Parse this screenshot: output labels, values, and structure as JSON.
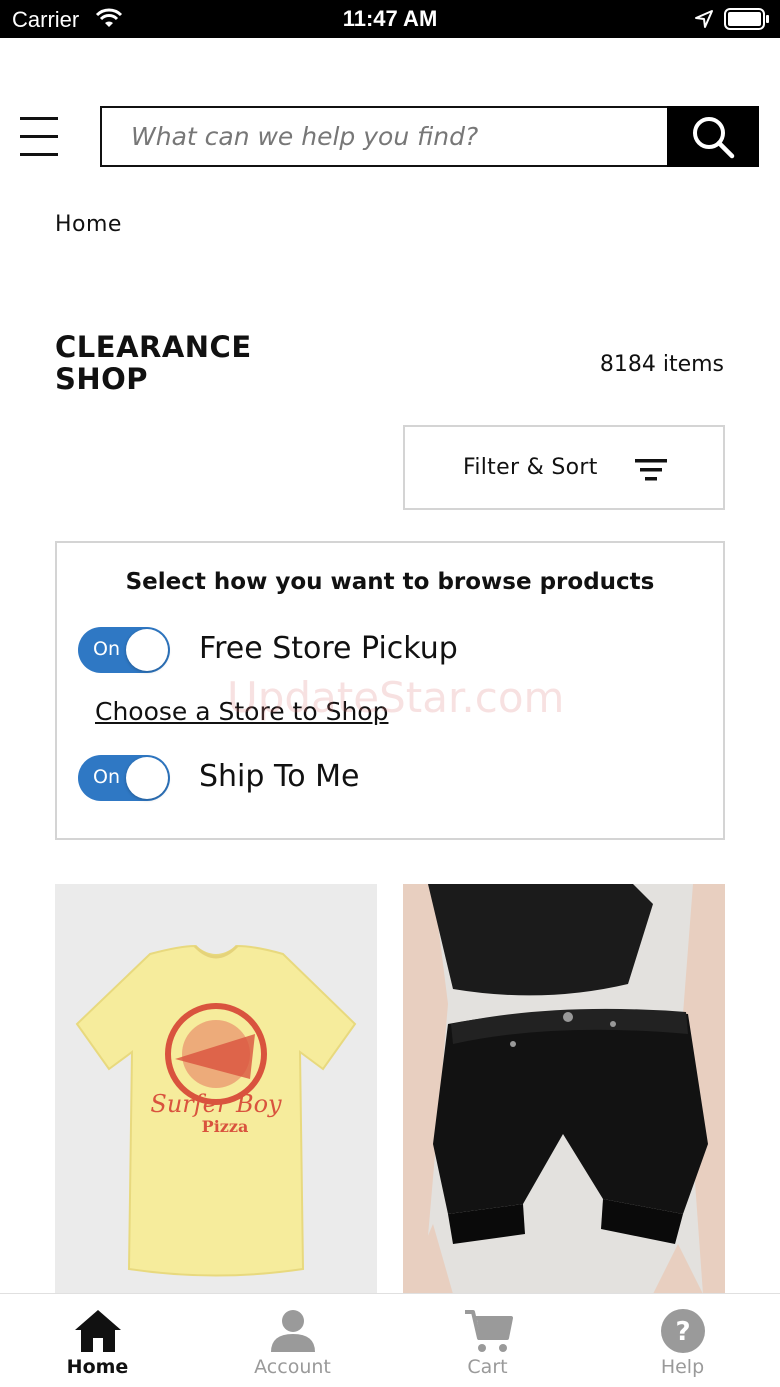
{
  "status_bar": {
    "carrier": "Carrier",
    "time": "11:47 AM"
  },
  "header": {
    "search_placeholder": "What can we help you find?",
    "menu_icon": "hamburger-icon",
    "search_icon": "search-icon"
  },
  "breadcrumb": "Home",
  "page": {
    "title_line1": "CLEARANCE",
    "title_line2": "SHOP",
    "item_count": "8184 items",
    "filter_label": "Filter & Sort"
  },
  "browse_panel": {
    "heading": "Select how you want to browse products",
    "pickup_toggle": {
      "state": "On",
      "label": "Free Store Pickup",
      "on": true
    },
    "store_link": "Choose a Store to Shop",
    "ship_toggle": {
      "state": "On",
      "label": "Ship To Me",
      "on": true
    },
    "watermark": "UpdateStar.com"
  },
  "products": [
    {
      "image": "yellow t-shirt with red Surfer Boy Pizza graphic",
      "graphic_text_1": "Surfer Boy",
      "graphic_text_2": "Pizza"
    },
    {
      "image": "black cut-off denim shorts with black tee"
    }
  ],
  "tab_bar": {
    "tabs": [
      {
        "label": "Home",
        "icon": "home-icon",
        "active": true
      },
      {
        "label": "Account",
        "icon": "account-icon",
        "active": false
      },
      {
        "label": "Cart",
        "icon": "cart-icon",
        "active": false
      },
      {
        "label": "Help",
        "icon": "help-icon",
        "active": false
      }
    ]
  },
  "colors": {
    "toggle_on": "#2f78c4",
    "primary_text": "#111111",
    "inactive_tab": "#9a9a9a",
    "search_button": "#000000"
  }
}
